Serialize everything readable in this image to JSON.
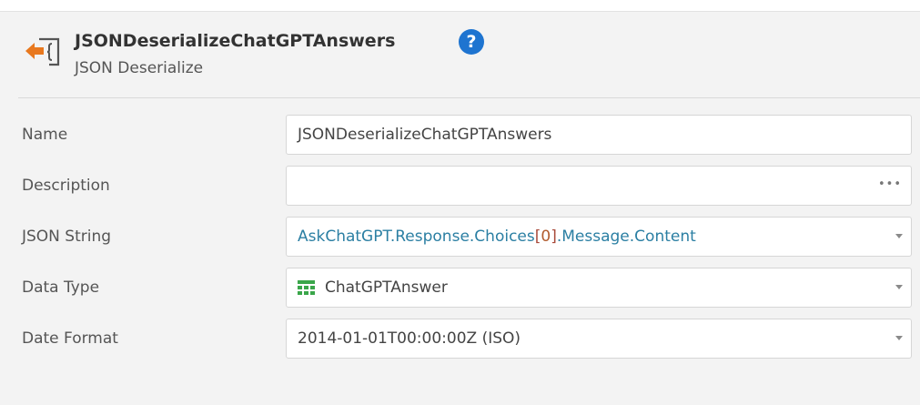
{
  "node": {
    "title": "JSONDeserializeChatGPTAnswers",
    "subtitle": "JSON Deserialize",
    "help_icon": "question-circle-icon",
    "node_icon": "json-deserialize-icon"
  },
  "properties": [
    {
      "label": "Name",
      "value": "JSONDeserializeChatGPTAnswers"
    },
    {
      "label": "Description",
      "value": ""
    },
    {
      "label": "JSON String",
      "value_parts": [
        "AskChatGPT.Response.Choices",
        "[",
        "0",
        "]",
        ".Message.Content"
      ]
    },
    {
      "label": "Data Type",
      "value": "ChatGPTAnswer",
      "icon": "structure-icon"
    },
    {
      "label": "Date Format",
      "value": "2014-01-01T00:00:00Z (ISO)"
    }
  ],
  "colors": {
    "expression": "#2b7fa3",
    "help": "#1e74d0",
    "icon_arrow": "#e8781e",
    "structure_icon": "#3aa64a"
  }
}
